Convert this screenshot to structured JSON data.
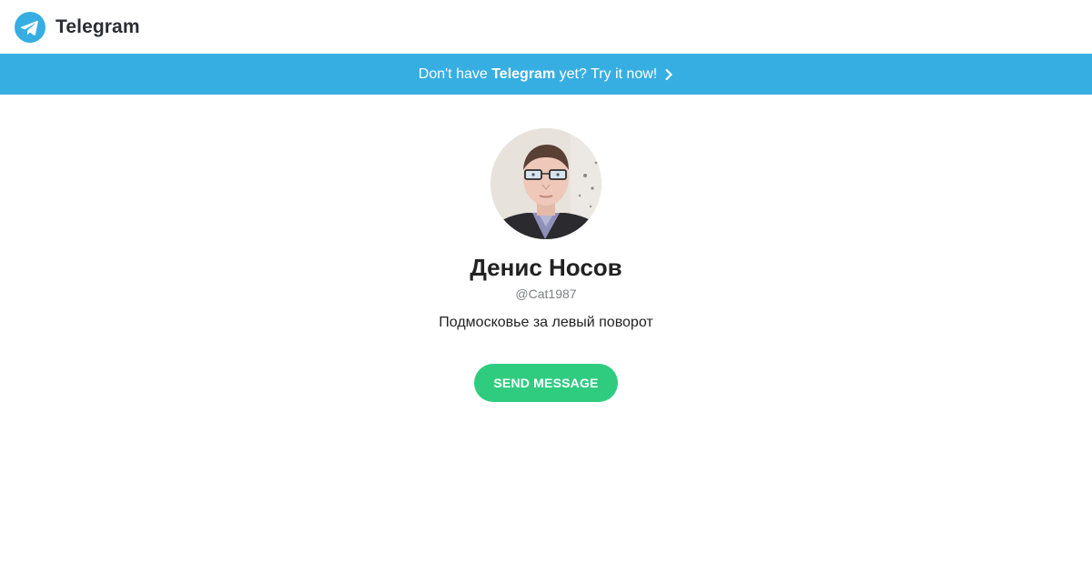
{
  "header": {
    "logo_text": "Telegram",
    "logo_icon": "telegram-plane-icon"
  },
  "promo": {
    "prefix": "Don't have ",
    "brand": "Telegram",
    "suffix": " yet? Try it now!",
    "icon": "chevron-right-icon"
  },
  "profile": {
    "name": "Денис Носов",
    "username": "@Cat1987",
    "bio": "Подмосковье за левый поворот",
    "send_button": "SEND MESSAGE"
  },
  "colors": {
    "brand_blue": "#37aee2",
    "send_green": "#2fcc80",
    "text_dark": "#222222",
    "text_muted": "#7d7f81"
  }
}
